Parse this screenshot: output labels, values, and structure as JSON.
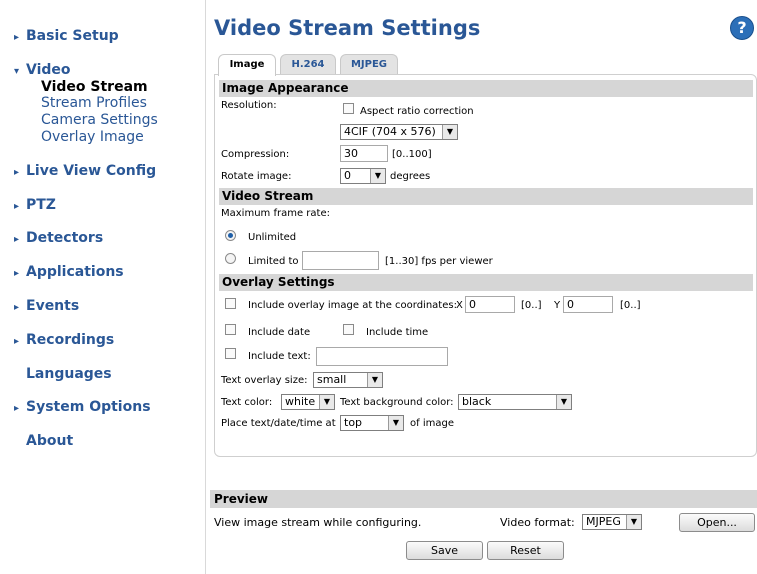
{
  "sidebar": {
    "items": [
      {
        "label": "Basic Setup",
        "arrow": "▸"
      },
      {
        "label": "Video",
        "arrow": "▾"
      },
      {
        "label": "Live View Config",
        "arrow": "▸"
      },
      {
        "label": "PTZ",
        "arrow": "▸"
      },
      {
        "label": "Detectors",
        "arrow": "▸"
      },
      {
        "label": "Applications",
        "arrow": "▸"
      },
      {
        "label": "Events",
        "arrow": "▸"
      },
      {
        "label": "Recordings",
        "arrow": "▸"
      },
      {
        "label": "Languages",
        "arrow": ""
      },
      {
        "label": "System Options",
        "arrow": "▸"
      },
      {
        "label": "About",
        "arrow": ""
      }
    ],
    "video_sub": [
      "Video Stream",
      "Stream Profiles",
      "Camera Settings",
      "Overlay Image"
    ]
  },
  "header": {
    "title": "Video Stream Settings",
    "help": "?"
  },
  "tabs": [
    "Image",
    "H.264",
    "MJPEG"
  ],
  "image_appearance": {
    "title": "Image Appearance",
    "resolution_label": "Resolution:",
    "aspect_label": "Aspect ratio correction",
    "resolution_value": "4CIF (704 x 576)",
    "compression_label": "Compression:",
    "compression_value": "30",
    "compression_range": "[0..100]",
    "rotate_label": "Rotate image:",
    "rotate_value": "0",
    "rotate_unit": "degrees"
  },
  "video_stream": {
    "title": "Video Stream",
    "max_frame_label": "Maximum frame rate:",
    "unlimited_label": "Unlimited",
    "limited_label": "Limited to",
    "limited_value": "",
    "limited_range": "[1..30] fps per viewer"
  },
  "overlay": {
    "title": "Overlay Settings",
    "include_image_label": "Include overlay image at the coordinates:",
    "x_label": "X",
    "x_value": "0",
    "x_range": "[0..]",
    "y_label": "Y",
    "y_value": "0",
    "y_range": "[0..]",
    "include_date_label": "Include date",
    "include_time_label": "Include time",
    "include_text_label": "Include text:",
    "include_text_value": "",
    "text_size_label": "Text overlay size:",
    "text_size_value": "small",
    "text_color_label": "Text color:",
    "text_color_value": "white",
    "text_bg_label": "Text background color:",
    "text_bg_value": "black",
    "place_label": "Place text/date/time at",
    "place_value": "top",
    "place_suffix": "of image"
  },
  "preview": {
    "title": "Preview",
    "desc": "View image stream while configuring.",
    "format_label": "Video format:",
    "format_value": "MJPEG",
    "open_label": "Open..."
  },
  "actions": {
    "save": "Save",
    "reset": "Reset"
  },
  "icons": {
    "dropdown": "▼"
  }
}
